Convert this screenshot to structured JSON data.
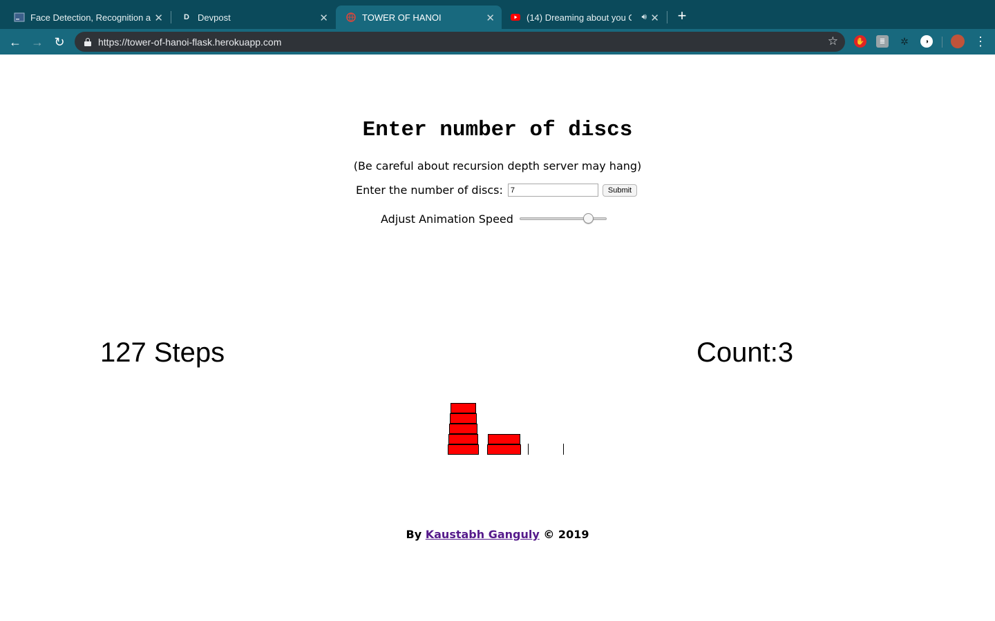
{
  "browser": {
    "tabs": [
      {
        "title": "Face Detection, Recognition an",
        "icon": "notebook-favicon-icon"
      },
      {
        "title": "Devpost",
        "icon": "devpost-favicon-icon",
        "glyph": "D"
      },
      {
        "title": "TOWER OF HANOI",
        "icon": "globe-favicon-icon"
      },
      {
        "title": "(14) Dreaming about you C",
        "icon": "youtube-favicon-icon"
      }
    ],
    "active_tab_index": 2,
    "url": "https://tower-of-hanoi-flask.herokuapp.com",
    "colors": {
      "tabbar": "#0b4a5b",
      "toolbar": "#18697e",
      "omnibox": "#2f3338"
    }
  },
  "page": {
    "heading": "Enter number of discs",
    "warning": "(Be careful about recursion depth server may hang)",
    "form": {
      "label": "Enter the number of discs:",
      "value": "7",
      "submit_label": "Submit"
    },
    "speed": {
      "label": "Adjust Animation Speed",
      "level": 0.82
    },
    "steps_text": "127 Steps",
    "count_text": "Count:3",
    "towers": {
      "disc_color": "#ff0000",
      "pegs": [
        {
          "discs": [
            5,
            4,
            3,
            2,
            1
          ]
        },
        {
          "discs": [
            7,
            6
          ]
        },
        {
          "discs": []
        }
      ]
    },
    "footer": {
      "prefix": "By",
      "author": "Kaustabh Ganguly",
      "suffix": "© 2019",
      "link_color": "#551a8b"
    }
  }
}
